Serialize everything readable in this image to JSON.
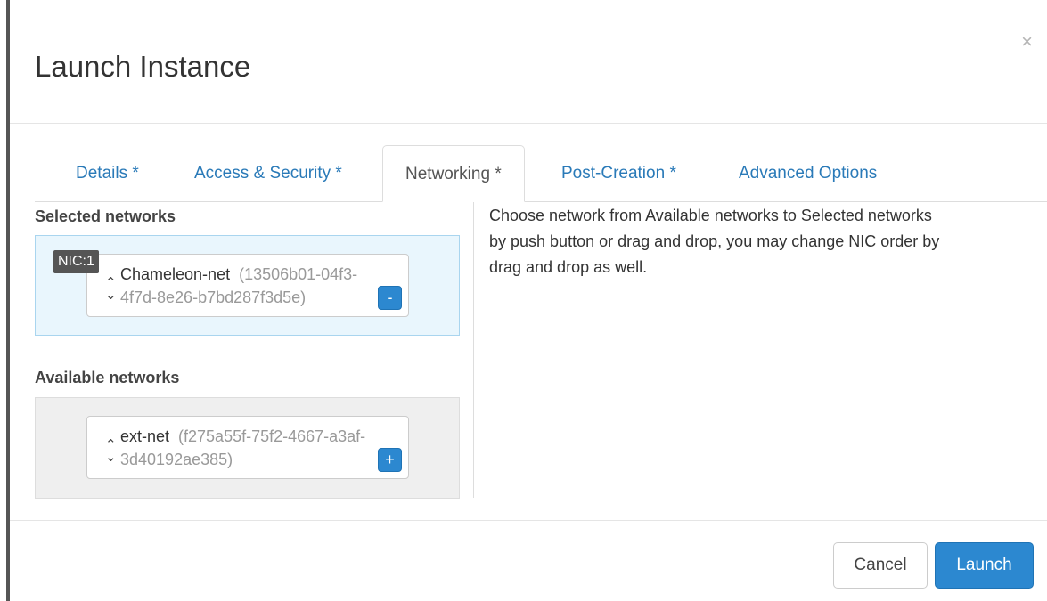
{
  "dialog": {
    "title": "Launch Instance",
    "close_label": "×"
  },
  "tabs": [
    {
      "label": "Details *"
    },
    {
      "label": "Access & Security *"
    },
    {
      "label": "Networking *"
    },
    {
      "label": "Post-Creation *"
    },
    {
      "label": "Advanced Options"
    }
  ],
  "active_tab": "Networking *",
  "selected": {
    "heading": "Selected networks",
    "networks": [
      {
        "nic_label": "NIC:1",
        "name": "Chameleon-net",
        "id_line1": "(13506b01-04f3-",
        "id_line2": "4f7d-8e26-b7bd287f3d5e)",
        "button_label": "-"
      }
    ]
  },
  "available": {
    "heading": "Available networks",
    "networks": [
      {
        "name": "ext-net",
        "id_line1": "(f275a55f-75f2-4667-a3af-",
        "id_line2": "3d40192ae385)",
        "button_label": "+"
      }
    ]
  },
  "help_text": "Choose network from Available networks to Selected networks by push button or drag and drop, you may change NIC order by drag and drop as well.",
  "footer": {
    "cancel_label": "Cancel",
    "launch_label": "Launch"
  },
  "colors": {
    "accent": "#2c88d0",
    "link": "#2a7ab8",
    "selected_well_bg": "#e9f6fd",
    "available_well_bg": "#efefef"
  }
}
